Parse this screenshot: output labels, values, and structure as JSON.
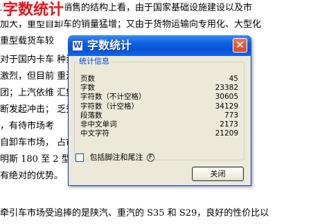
{
  "document": {
    "overlay_title": "字数统计",
    "lines": [
      "从上游的商务车销售的结构上看，由于国家基础设施建设以及市",
      "加大，重型自卸车的销量猛增；又由于货物运输向专用化、大型化",
      "重型载货车较",
      "对于国内卡车                                    种资本纷纷进入",
      "激烈，但目前                                    重汽、陕汽、四",
      "团；上汽依维                                    汇集团，将向卡",
      "断发起冲击；                                    乏秀或许会后来",
      "，有待市场考",
      "自卸车市场，                                    占市场的 70%以",
      "  明斯 180 至 2                                   型的配置使得该",
      "有绝对的优势。",
      "牵引车市场受追捧的是陕汽、重汽的 S35 和 S29，良好的性价比以"
    ]
  },
  "dialog": {
    "title": "字数统计",
    "icon_glyph": "W",
    "close_glyph": "✕",
    "group_label": "统计信息",
    "stats": [
      {
        "label": "页数",
        "value": "45"
      },
      {
        "label": "字数",
        "value": "23382"
      },
      {
        "label": "字符数（不计空格）",
        "value": "30605"
      },
      {
        "label": "字符数（计空格）",
        "value": "34129"
      },
      {
        "label": "段落数",
        "value": "773"
      },
      {
        "label": "非中文单词",
        "value": "2173"
      },
      {
        "label": "中文字符",
        "value": "21209"
      }
    ],
    "checkbox_label": "包括脚注和尾注",
    "checkbox_shortcut": "F",
    "checkbox_checked": false,
    "close_button_label": "关闭"
  },
  "colors": {
    "title_bar": "#0a52d6",
    "overlay_title": "#e8141e",
    "group_label": "#0046d5"
  }
}
